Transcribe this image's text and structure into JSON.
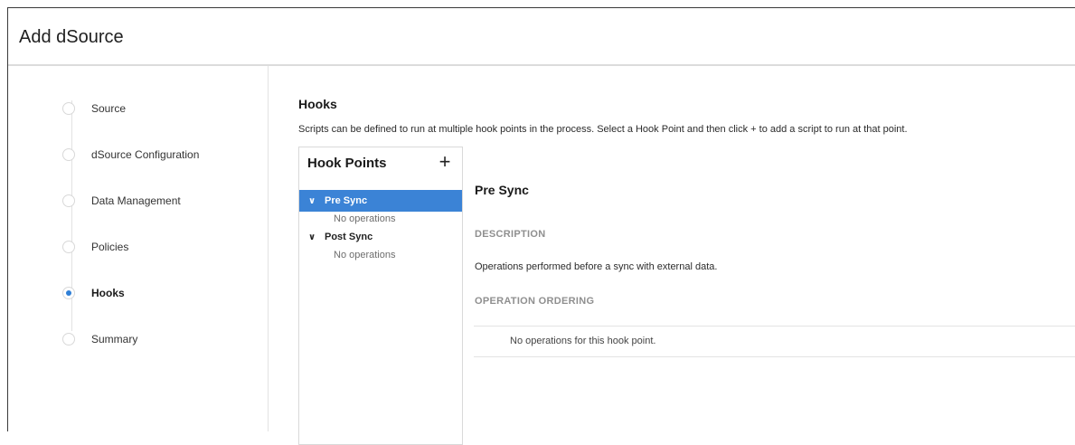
{
  "window": {
    "title": "Add dSource"
  },
  "steps": [
    {
      "label": "Source",
      "active": false
    },
    {
      "label": "dSource Configuration",
      "active": false
    },
    {
      "label": "Data Management",
      "active": false
    },
    {
      "label": "Policies",
      "active": false
    },
    {
      "label": "Hooks",
      "active": true
    },
    {
      "label": "Summary",
      "active": false
    }
  ],
  "main": {
    "heading": "Hooks",
    "description": "Scripts can be defined to run at multiple hook points in the process. Select a Hook Point and then click + to add a script to run at that point."
  },
  "hook_points": {
    "title": "Hook Points",
    "add_label": "+",
    "items": [
      {
        "label": "Pre Sync",
        "sub": "No operations",
        "selected": true,
        "chevron": "∨"
      },
      {
        "label": "Post Sync",
        "sub": "No operations",
        "selected": false,
        "chevron": "∨"
      }
    ]
  },
  "detail": {
    "title": "Pre Sync",
    "description_label": "DESCRIPTION",
    "description_text": "Operations performed before a sync with external data.",
    "ordering_label": "OPERATION ORDERING",
    "empty_ops": "No operations for this hook point."
  },
  "colors": {
    "accent": "#3b83d6",
    "step_dot_active": "#2f7fd6"
  }
}
